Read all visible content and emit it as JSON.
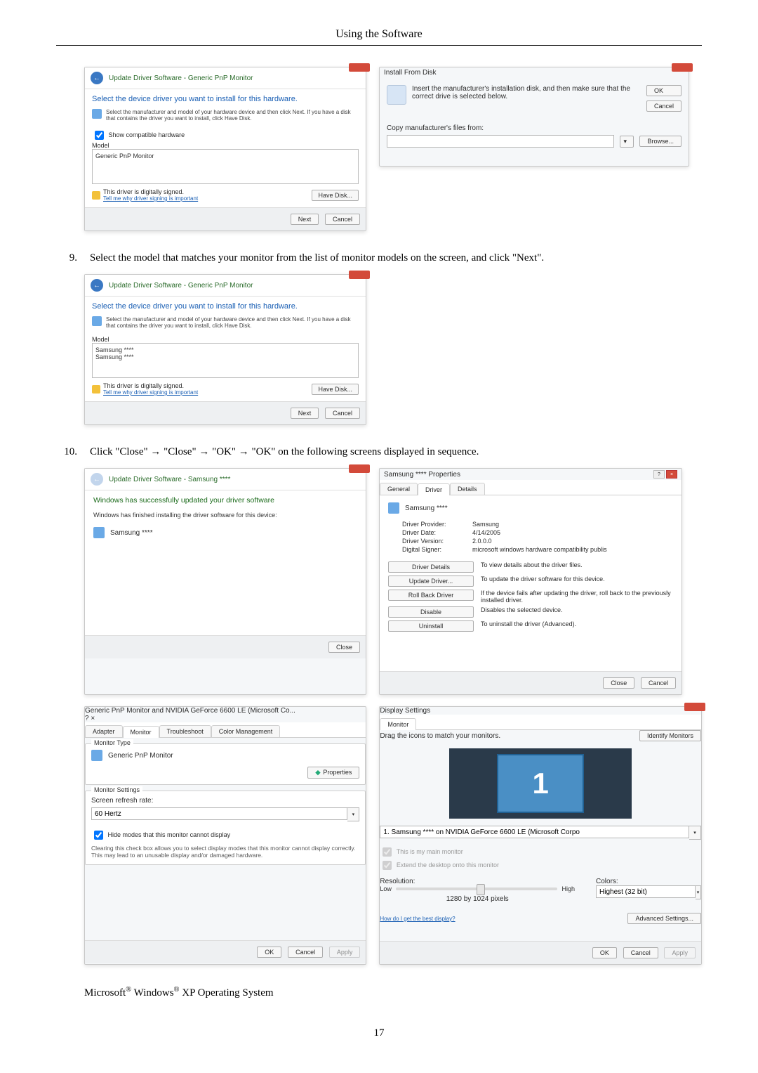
{
  "page": {
    "header": "Using the Software",
    "number": "17"
  },
  "steps": {
    "s9_num": "9.",
    "s9_text": "Select the model that matches your monitor from the list of monitor models on the screen, and click \"Next\".",
    "s10_num": "10.",
    "s10_text": "Click \"Close\" → \"Close\" → \"OK\" → \"OK\" on the following screens displayed in sequence."
  },
  "common": {
    "next": "Next",
    "cancel": "Cancel",
    "close": "Close",
    "ok": "OK",
    "apply": "Apply",
    "browse": "Browse...",
    "have_disk": "Have Disk..."
  },
  "wiz_generic": {
    "header": "Update Driver Software - Generic PnP Monitor",
    "title": "Select the device driver you want to install for this hardware.",
    "note": "Select the manufacturer and model of your hardware device and then click Next. If you have a disk that contains the driver you want to install, click Have Disk.",
    "show_compat": "Show compatible hardware",
    "model_caption": "Model",
    "model_item": "Generic PnP Monitor",
    "signed": "This driver is digitally signed.",
    "tell_me": "Tell me why driver signing is important"
  },
  "ifd": {
    "title": "Install From Disk",
    "msg": "Insert the manufacturer's installation disk, and then make sure that the correct drive is selected below.",
    "copy": "Copy manufacturer's files from:",
    "path": ""
  },
  "wiz_samsung_select": {
    "header": "Update Driver Software - Generic PnP Monitor",
    "title": "Select the device driver you want to install for this hardware.",
    "note": "Select the manufacturer and model of your hardware device and then click Next. If you have a disk that contains the driver you want to install, click Have Disk.",
    "model_caption": "Model",
    "m1": "Samsung ****",
    "m2": "Samsung ****",
    "signed": "This driver is digitally signed.",
    "tell_me": "Tell me why driver signing is important"
  },
  "wiz_success": {
    "header": "Update Driver Software - Samsung ****",
    "line1": "Windows has successfully updated your driver software",
    "line2": "Windows has finished installing the driver software for this device:",
    "dev": "Samsung ****"
  },
  "props": {
    "title": "Samsung **** Properties",
    "tab_general": "General",
    "tab_driver": "Driver",
    "tab_details": "Details",
    "dev": "Samsung ****",
    "k_provider": "Driver Provider:",
    "v_provider": "Samsung",
    "k_date": "Driver Date:",
    "v_date": "4/14/2005",
    "k_version": "Driver Version:",
    "v_version": "2.0.0.0",
    "k_signer": "Digital Signer:",
    "v_signer": "microsoft windows hardware compatibility publis",
    "b_details": "Driver Details",
    "d_details": "To view details about the driver files.",
    "b_update": "Update Driver...",
    "d_update": "To update the driver software for this device.",
    "b_rollback": "Roll Back Driver",
    "d_rollback": "If the device fails after updating the driver, roll back to the previously installed driver.",
    "b_disable": "Disable",
    "d_disable": "Disables the selected device.",
    "b_uninstall": "Uninstall",
    "d_uninstall": "To uninstall the driver (Advanced)."
  },
  "monprops": {
    "title": "Generic PnP Monitor and NVIDIA GeForce 6600 LE (Microsoft Co...",
    "tab_adapter": "Adapter",
    "tab_monitor": "Monitor",
    "tab_trouble": "Troubleshoot",
    "tab_color": "Color Management",
    "mtype_caption": "Monitor Type",
    "mtype_value": "Generic PnP Monitor",
    "properties": "Properties",
    "msettings_caption": "Monitor Settings",
    "refresh_label": "Screen refresh rate:",
    "refresh_value": "60 Hertz",
    "hide": "Hide modes that this monitor cannot display",
    "hide_note": "Clearing this check box allows you to select display modes that this monitor cannot display correctly. This may lead to an unusable display and/or damaged hardware."
  },
  "disp": {
    "title": "Display Settings",
    "tab_monitor": "Monitor",
    "drag": "Drag the icons to match your monitors.",
    "identify": "Identify Monitors",
    "mon_num": "1",
    "select": "1. Samsung **** on NVIDIA GeForce 6600 LE (Microsoft Corpo",
    "main": "This is my main monitor",
    "extend": "Extend the desktop onto this monitor",
    "res_label": "Resolution:",
    "low": "Low",
    "high": "High",
    "res_value": "1280 by 1024 pixels",
    "colors_label": "Colors:",
    "colors_value": "Highest (32 bit)",
    "howdo": "How do I get the best display?",
    "advanced": "Advanced Settings..."
  },
  "final": {
    "prefix": "Microsoft",
    "reg": "®",
    "mid": " Windows",
    "suffix": " XP Operating System"
  }
}
